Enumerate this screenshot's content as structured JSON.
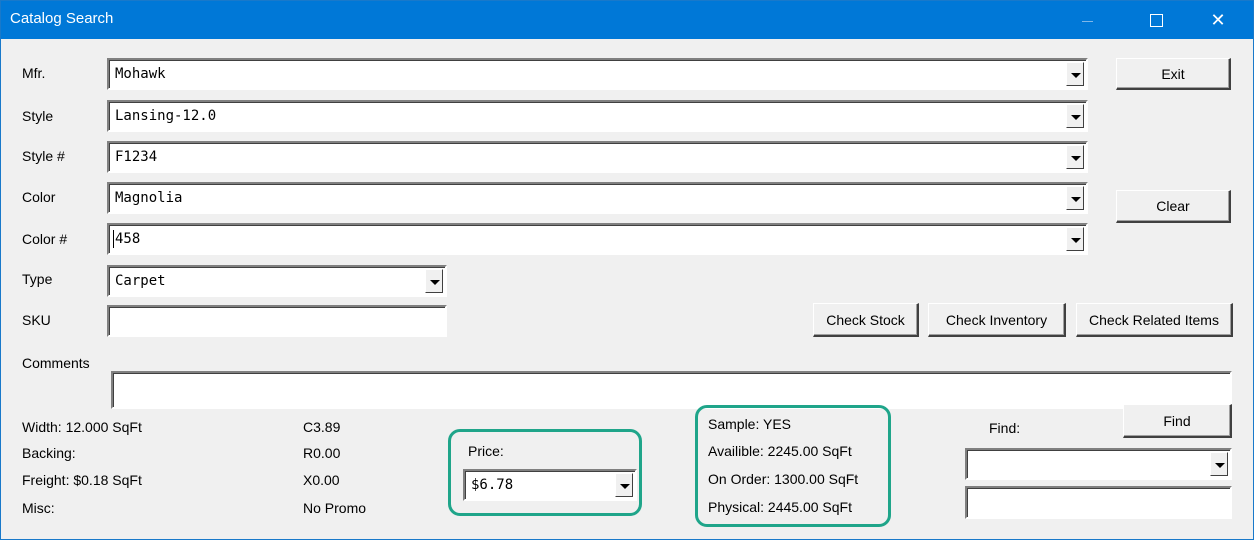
{
  "window": {
    "title": "Catalog Search",
    "controls": {
      "minimize": "minimize-icon",
      "maximize": "maximize-icon",
      "close": "close-icon"
    }
  },
  "fields": {
    "mfr": {
      "label": "Mfr.",
      "value": "Mohawk"
    },
    "style": {
      "label": "Style",
      "value": "Lansing-12.0"
    },
    "style_no": {
      "label": "Style #",
      "value": "F1234"
    },
    "color": {
      "label": "Color",
      "value": "Magnolia"
    },
    "color_no": {
      "label": "Color #",
      "value": "458"
    },
    "type": {
      "label": "Type",
      "value": "Carpet"
    },
    "sku": {
      "label": "SKU",
      "value": ""
    },
    "comments": {
      "label": "Comments",
      "value": ""
    }
  },
  "buttons": {
    "exit": "Exit",
    "clear": "Clear",
    "check_stock": "Check Stock",
    "check_inventory": "Check Inventory",
    "check_related": "Check Related Items",
    "find": "Find"
  },
  "details": {
    "width": "Width:  12.000 SqFt",
    "backing": "Backing:",
    "freight": "Freight:  $0.18 SqFt",
    "misc": "Misc:",
    "code_c": "C3.89",
    "code_r": "R0.00",
    "code_x": "X0.00",
    "promo": "No Promo"
  },
  "price": {
    "label": "Price:",
    "value": "$6.78"
  },
  "stock": {
    "sample": "Sample: YES",
    "available": "Availible:  2245.00 SqFt",
    "on_order": "On Order:  1300.00 SqFt",
    "physical": "Physical:  2445.00 SqFt"
  },
  "find": {
    "label": "Find:",
    "select_value": "",
    "text_value": ""
  },
  "colors": {
    "titlebar": "#0078d7",
    "highlight": "#1fa58a",
    "face": "#f0f0f0"
  }
}
